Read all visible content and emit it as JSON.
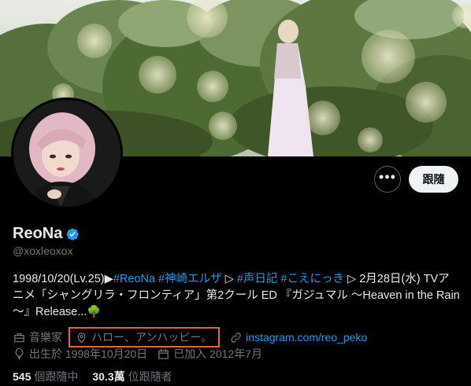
{
  "profile": {
    "display_name": "ReoNa",
    "handle": "@xoxleoxox",
    "verified": true,
    "follow_button_label": "跟隨",
    "more_button_label": "•••"
  },
  "bio": {
    "segments": [
      {
        "text": "1998/10/20(Lv.25)▶",
        "type": "text"
      },
      {
        "text": "#ReoNa",
        "type": "link"
      },
      {
        "text": " ",
        "type": "text"
      },
      {
        "text": "#神崎エルザ",
        "type": "link"
      },
      {
        "text": " ▷ ",
        "type": "text"
      },
      {
        "text": "#声日記",
        "type": "link"
      },
      {
        "text": " ",
        "type": "text"
      },
      {
        "text": "#こえにっき",
        "type": "link"
      },
      {
        "text": " ▷ 2月28日(水) TVアニメ「シャングリラ・フロンティア」第2クール ED 『ガジュマル ～Heaven in the Rain～』Release...🌳",
        "type": "text"
      }
    ]
  },
  "meta": {
    "profession": "音樂家",
    "location": "ハロー、アンハッピー。",
    "website": "instagram.com/reo_peko",
    "birthday": "出生於 1998年10月20日",
    "joined": "已加入 2012年7月"
  },
  "counts": {
    "following_num": "545",
    "following_label": "個跟隨中",
    "followers_num": "30.3萬",
    "followers_label": "位跟隨者"
  },
  "colors": {
    "background": "#000000",
    "text_primary": "#e7e9ea",
    "text_secondary": "#71767b",
    "link": "#1d9bf0",
    "highlight_box": "#e8623d",
    "follow_button_bg": "#eff3f4"
  },
  "icons": {
    "verified": "verified-badge-icon",
    "profession": "briefcase-icon",
    "location": "location-pin-icon",
    "website": "link-icon",
    "birthday": "balloon-icon",
    "joined": "calendar-icon",
    "more": "more-dots-icon"
  }
}
